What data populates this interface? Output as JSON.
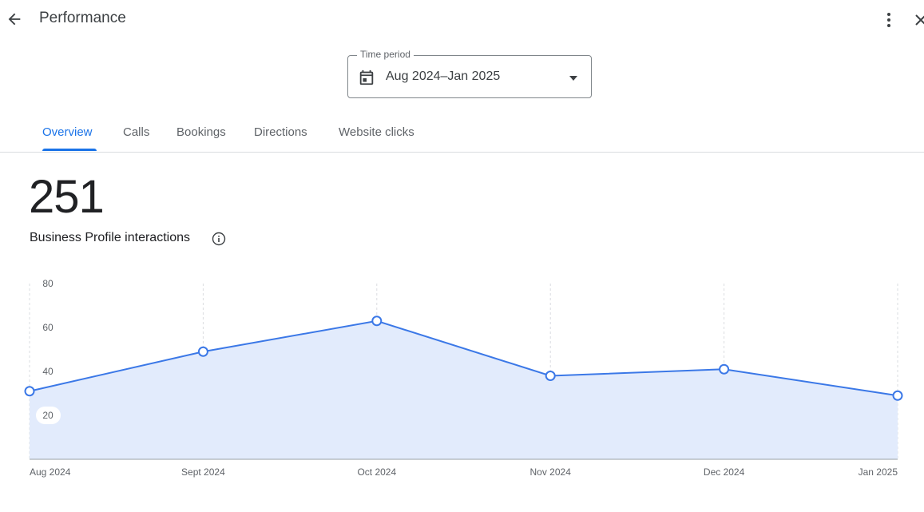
{
  "header": {
    "title": "Performance",
    "back_icon": "arrow-back-icon",
    "more_icon": "more-vert-icon",
    "close_icon": "close-icon"
  },
  "time_period": {
    "label": "Time period",
    "value": "Aug 2024–Jan 2025",
    "calendar_icon": "calendar-icon",
    "dropdown_icon": "arrow-drop-down-icon"
  },
  "tabs": [
    {
      "label": "Overview",
      "active": true
    },
    {
      "label": "Calls",
      "active": false
    },
    {
      "label": "Bookings",
      "active": false
    },
    {
      "label": "Directions",
      "active": false
    },
    {
      "label": "Website clicks",
      "active": false
    }
  ],
  "metric": {
    "value": "251",
    "label": "Business Profile interactions",
    "info_icon": "info-icon"
  },
  "colors": {
    "accent": "#1a73e8",
    "line": "#3b78e7",
    "area_fill": "#e2ebfc",
    "text_primary": "#202124",
    "text_secondary": "#5f6368"
  },
  "chart_data": {
    "type": "area",
    "categories": [
      "Aug 2024",
      "Sept 2024",
      "Oct 2024",
      "Nov 2024",
      "Dec 2024",
      "Jan 2025"
    ],
    "values": [
      31,
      49,
      63,
      38,
      41,
      29
    ],
    "y_ticks": [
      "80",
      "60",
      "40",
      "20"
    ],
    "ylim": [
      0,
      80
    ],
    "grid": "vertical-dashed",
    "xlabel": "",
    "ylabel": ""
  }
}
